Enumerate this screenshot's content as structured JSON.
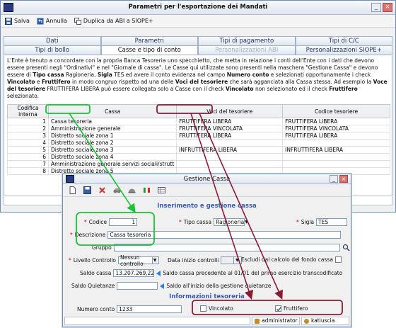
{
  "main_window": {
    "title": "Parametri per l'esportazione dei Mandati",
    "toolbar": {
      "save": "Salva",
      "cancel": "Annulla",
      "duplicate": "Duplica da ABI a SIOPE+"
    },
    "tabs_row1": [
      "Dati",
      "Parametri",
      "Tipi di pagamento",
      "Tipi di C/C"
    ],
    "tabs_row2": [
      "Tipi di bollo",
      "Casse e tipo di conto",
      "Personalizzazioni ABI",
      "Personalizzazioni SIOPE+"
    ],
    "description": {
      "p1": "L'Ente è tenuto a concordare con la propria Banca Tesoreria uno specchietto, che metta in relazione i conti dell'Ente con i dati che devono essere presenti negli \"Ordinativi\" e nel \"Giornale di cassa\". Le Casse qui utilizzate sono presenti nella maschera \"Gestione Cassa\" e devono essere di ",
      "b1": "Tipo cassa",
      "p2": " Ragioneria, ",
      "b2": "Sigla",
      "p3": " TES ed avere il conto evidenza nel campo ",
      "b3": "Numero conto",
      "p4": " e selezionati opportunamente i check ",
      "b4": "Vincolato",
      "p5": " e ",
      "b5": "Fruttifero",
      "p6": " in modo congruo rispetto ad una delle ",
      "b6": "Voci del tesoriere",
      "p7": " che sarà agganciata alla Cassa stessa. Ad esempio la ",
      "b7": "Voce del tesoriere",
      "p8": " FRUTTIFERA LIBERA può essere collegata solo a Casse con il check ",
      "b8": "Vincolato",
      "p9": " non selezionato ed il check ",
      "b9": "Fruttifero",
      "p10": " selezionato."
    },
    "table": {
      "headers": [
        "Codifica interna",
        "Cassa",
        "Voci del tesoriere",
        "Codice tesoriere"
      ],
      "rows": [
        [
          "1",
          "Cassa tesoreria",
          "FRUTTIFERA LIBERA",
          "FRUTTIFERA LIBERA"
        ],
        [
          "2",
          "Amministrazione generale",
          "FRUTTIFERA VINCOLATA",
          "FRUTTIFERA VINCOLATA"
        ],
        [
          "3",
          "Distretto sociale zona 1",
          "FRUTTIFERA LIBERA",
          "FRUTTIFERA LIBERA"
        ],
        [
          "4",
          "Distretto sociale zona 2",
          "",
          ""
        ],
        [
          "5",
          "Distretto sociale zona 3",
          "INFRUTTIFERA LIBERA",
          "INFRUTTIFERA LIBERA"
        ],
        [
          "6",
          "Distretto sociale zona 4",
          "",
          ""
        ],
        [
          "7",
          "Amministrazione generale servizi sociali/strutt",
          "",
          ""
        ],
        [
          "8",
          "Distretto sociale zona 5",
          "",
          ""
        ]
      ]
    }
  },
  "dialog": {
    "title": "Gestione Cassa",
    "section1": "Inserimento e gestione cassa",
    "section2": "Informazioni tesoreria",
    "codice_label": "Codice",
    "codice": "1",
    "tipo_cassa_label": "Tipo cassa",
    "tipo_cassa": "Ragioneria",
    "sigla_label": "Sigla",
    "sigla": "TES",
    "descrizione_label": "Descrizione",
    "descrizione": "Cassa tesoreria",
    "gruppo_label": "Gruppo",
    "livello_label": "Livello Controllo",
    "livello": "Nessun controllo",
    "data_inizio_label": "Data inizio controlli",
    "escludi_label": "Escludi dal calcolo del fondo cassa",
    "saldo_cassa_label": "Saldo cassa",
    "saldo_cassa": "13.207.269,22",
    "saldo_cassa_note": "Saldo cassa precedente al 01/01 del primo esercizio transcodificato",
    "saldo_quietanze_label": "Saldo Quietanze",
    "saldo_quietanze_note": "Saldo all'inizio della gestione quietanze",
    "numero_conto_label": "Numero conto",
    "numero_conto": "1233",
    "vincolato_label": "Vincolato",
    "vincolato_checked": false,
    "fruttifero_label": "Fruttifero",
    "fruttifero_checked": true,
    "status_user": "administrator",
    "status_user2": "katiuscia"
  }
}
